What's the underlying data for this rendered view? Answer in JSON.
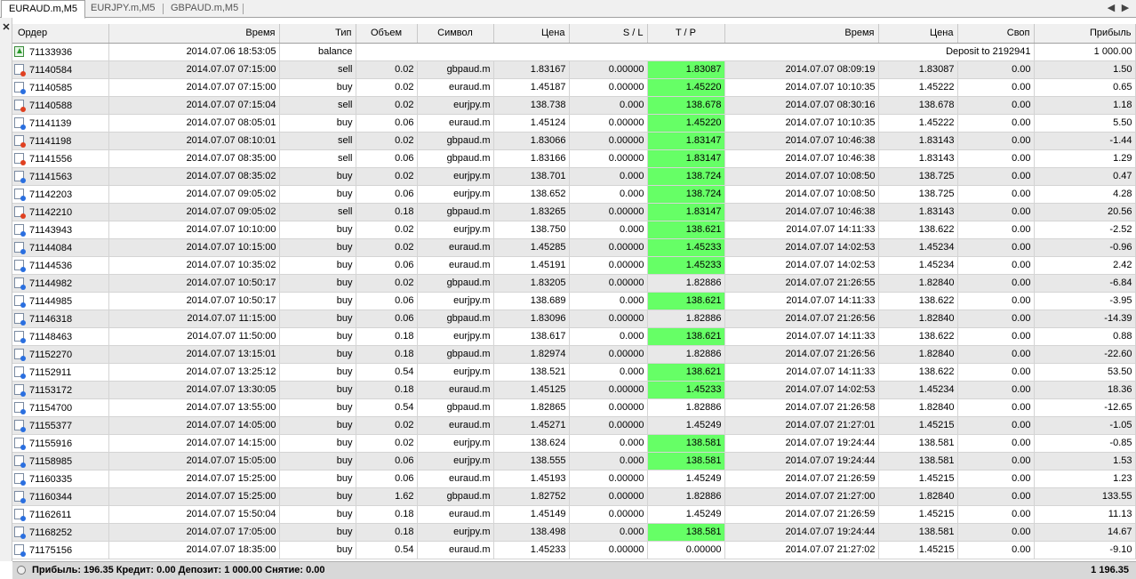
{
  "tabs": [
    {
      "label": "EURAUD.m,M5",
      "active": true
    },
    {
      "label": "EURJPY.m,M5",
      "active": false
    },
    {
      "label": "GBPAUD.m,M5",
      "active": false
    }
  ],
  "columns": [
    "Ордер",
    "Время",
    "Тип",
    "Объем",
    "Символ",
    "Цена",
    "S / L",
    "T / P",
    "Время",
    "Цена",
    "Своп",
    "Прибыль"
  ],
  "balance_row": {
    "order": "71133936",
    "time": "2014.07.06 18:53:05",
    "type": "balance",
    "comment": "Deposit to 2192941",
    "profit": "1 000.00"
  },
  "rows": [
    {
      "order": "71140584",
      "open_time": "2014.07.07 07:15:00",
      "type": "sell",
      "volume": "0.02",
      "symbol": "gbpaud.m",
      "open_price": "1.83167",
      "sl": "0.00000",
      "tp": "1.83087",
      "tp_hit": true,
      "close_time": "2014.07.07 08:09:19",
      "close_price": "1.83087",
      "swap": "0.00",
      "profit": "1.50"
    },
    {
      "order": "71140585",
      "open_time": "2014.07.07 07:15:00",
      "type": "buy",
      "volume": "0.02",
      "symbol": "euraud.m",
      "open_price": "1.45187",
      "sl": "0.00000",
      "tp": "1.45220",
      "tp_hit": true,
      "close_time": "2014.07.07 10:10:35",
      "close_price": "1.45222",
      "swap": "0.00",
      "profit": "0.65"
    },
    {
      "order": "71140588",
      "open_time": "2014.07.07 07:15:04",
      "type": "sell",
      "volume": "0.02",
      "symbol": "eurjpy.m",
      "open_price": "138.738",
      "sl": "0.000",
      "tp": "138.678",
      "tp_hit": true,
      "close_time": "2014.07.07 08:30:16",
      "close_price": "138.678",
      "swap": "0.00",
      "profit": "1.18"
    },
    {
      "order": "71141139",
      "open_time": "2014.07.07 08:05:01",
      "type": "buy",
      "volume": "0.06",
      "symbol": "euraud.m",
      "open_price": "1.45124",
      "sl": "0.00000",
      "tp": "1.45220",
      "tp_hit": true,
      "close_time": "2014.07.07 10:10:35",
      "close_price": "1.45222",
      "swap": "0.00",
      "profit": "5.50"
    },
    {
      "order": "71141198",
      "open_time": "2014.07.07 08:10:01",
      "type": "sell",
      "volume": "0.02",
      "symbol": "gbpaud.m",
      "open_price": "1.83066",
      "sl": "0.00000",
      "tp": "1.83147",
      "tp_hit": true,
      "close_time": "2014.07.07 10:46:38",
      "close_price": "1.83143",
      "swap": "0.00",
      "profit": "-1.44"
    },
    {
      "order": "71141556",
      "open_time": "2014.07.07 08:35:00",
      "type": "sell",
      "volume": "0.06",
      "symbol": "gbpaud.m",
      "open_price": "1.83166",
      "sl": "0.00000",
      "tp": "1.83147",
      "tp_hit": true,
      "close_time": "2014.07.07 10:46:38",
      "close_price": "1.83143",
      "swap": "0.00",
      "profit": "1.29"
    },
    {
      "order": "71141563",
      "open_time": "2014.07.07 08:35:02",
      "type": "buy",
      "volume": "0.02",
      "symbol": "eurjpy.m",
      "open_price": "138.701",
      "sl": "0.000",
      "tp": "138.724",
      "tp_hit": true,
      "close_time": "2014.07.07 10:08:50",
      "close_price": "138.725",
      "swap": "0.00",
      "profit": "0.47"
    },
    {
      "order": "71142203",
      "open_time": "2014.07.07 09:05:02",
      "type": "buy",
      "volume": "0.06",
      "symbol": "eurjpy.m",
      "open_price": "138.652",
      "sl": "0.000",
      "tp": "138.724",
      "tp_hit": true,
      "close_time": "2014.07.07 10:08:50",
      "close_price": "138.725",
      "swap": "0.00",
      "profit": "4.28"
    },
    {
      "order": "71142210",
      "open_time": "2014.07.07 09:05:02",
      "type": "sell",
      "volume": "0.18",
      "symbol": "gbpaud.m",
      "open_price": "1.83265",
      "sl": "0.00000",
      "tp": "1.83147",
      "tp_hit": true,
      "close_time": "2014.07.07 10:46:38",
      "close_price": "1.83143",
      "swap": "0.00",
      "profit": "20.56"
    },
    {
      "order": "71143943",
      "open_time": "2014.07.07 10:10:00",
      "type": "buy",
      "volume": "0.02",
      "symbol": "eurjpy.m",
      "open_price": "138.750",
      "sl": "0.000",
      "tp": "138.621",
      "tp_hit": true,
      "close_time": "2014.07.07 14:11:33",
      "close_price": "138.622",
      "swap": "0.00",
      "profit": "-2.52"
    },
    {
      "order": "71144084",
      "open_time": "2014.07.07 10:15:00",
      "type": "buy",
      "volume": "0.02",
      "symbol": "euraud.m",
      "open_price": "1.45285",
      "sl": "0.00000",
      "tp": "1.45233",
      "tp_hit": true,
      "close_time": "2014.07.07 14:02:53",
      "close_price": "1.45234",
      "swap": "0.00",
      "profit": "-0.96"
    },
    {
      "order": "71144536",
      "open_time": "2014.07.07 10:35:02",
      "type": "buy",
      "volume": "0.06",
      "symbol": "euraud.m",
      "open_price": "1.45191",
      "sl": "0.00000",
      "tp": "1.45233",
      "tp_hit": true,
      "close_time": "2014.07.07 14:02:53",
      "close_price": "1.45234",
      "swap": "0.00",
      "profit": "2.42"
    },
    {
      "order": "71144982",
      "open_time": "2014.07.07 10:50:17",
      "type": "buy",
      "volume": "0.02",
      "symbol": "gbpaud.m",
      "open_price": "1.83205",
      "sl": "0.00000",
      "tp": "1.82886",
      "tp_hit": false,
      "close_time": "2014.07.07 21:26:55",
      "close_price": "1.82840",
      "swap": "0.00",
      "profit": "-6.84"
    },
    {
      "order": "71144985",
      "open_time": "2014.07.07 10:50:17",
      "type": "buy",
      "volume": "0.06",
      "symbol": "eurjpy.m",
      "open_price": "138.689",
      "sl": "0.000",
      "tp": "138.621",
      "tp_hit": true,
      "close_time": "2014.07.07 14:11:33",
      "close_price": "138.622",
      "swap": "0.00",
      "profit": "-3.95"
    },
    {
      "order": "71146318",
      "open_time": "2014.07.07 11:15:00",
      "type": "buy",
      "volume": "0.06",
      "symbol": "gbpaud.m",
      "open_price": "1.83096",
      "sl": "0.00000",
      "tp": "1.82886",
      "tp_hit": false,
      "close_time": "2014.07.07 21:26:56",
      "close_price": "1.82840",
      "swap": "0.00",
      "profit": "-14.39"
    },
    {
      "order": "71148463",
      "open_time": "2014.07.07 11:50:00",
      "type": "buy",
      "volume": "0.18",
      "symbol": "eurjpy.m",
      "open_price": "138.617",
      "sl": "0.000",
      "tp": "138.621",
      "tp_hit": true,
      "close_time": "2014.07.07 14:11:33",
      "close_price": "138.622",
      "swap": "0.00",
      "profit": "0.88"
    },
    {
      "order": "71152270",
      "open_time": "2014.07.07 13:15:01",
      "type": "buy",
      "volume": "0.18",
      "symbol": "gbpaud.m",
      "open_price": "1.82974",
      "sl": "0.00000",
      "tp": "1.82886",
      "tp_hit": false,
      "close_time": "2014.07.07 21:26:56",
      "close_price": "1.82840",
      "swap": "0.00",
      "profit": "-22.60"
    },
    {
      "order": "71152911",
      "open_time": "2014.07.07 13:25:12",
      "type": "buy",
      "volume": "0.54",
      "symbol": "eurjpy.m",
      "open_price": "138.521",
      "sl": "0.000",
      "tp": "138.621",
      "tp_hit": true,
      "close_time": "2014.07.07 14:11:33",
      "close_price": "138.622",
      "swap": "0.00",
      "profit": "53.50"
    },
    {
      "order": "71153172",
      "open_time": "2014.07.07 13:30:05",
      "type": "buy",
      "volume": "0.18",
      "symbol": "euraud.m",
      "open_price": "1.45125",
      "sl": "0.00000",
      "tp": "1.45233",
      "tp_hit": true,
      "close_time": "2014.07.07 14:02:53",
      "close_price": "1.45234",
      "swap": "0.00",
      "profit": "18.36"
    },
    {
      "order": "71154700",
      "open_time": "2014.07.07 13:55:00",
      "type": "buy",
      "volume": "0.54",
      "symbol": "gbpaud.m",
      "open_price": "1.82865",
      "sl": "0.00000",
      "tp": "1.82886",
      "tp_hit": false,
      "close_time": "2014.07.07 21:26:58",
      "close_price": "1.82840",
      "swap": "0.00",
      "profit": "-12.65"
    },
    {
      "order": "71155377",
      "open_time": "2014.07.07 14:05:00",
      "type": "buy",
      "volume": "0.02",
      "symbol": "euraud.m",
      "open_price": "1.45271",
      "sl": "0.00000",
      "tp": "1.45249",
      "tp_hit": false,
      "close_time": "2014.07.07 21:27:01",
      "close_price": "1.45215",
      "swap": "0.00",
      "profit": "-1.05"
    },
    {
      "order": "71155916",
      "open_time": "2014.07.07 14:15:00",
      "type": "buy",
      "volume": "0.02",
      "symbol": "eurjpy.m",
      "open_price": "138.624",
      "sl": "0.000",
      "tp": "138.581",
      "tp_hit": true,
      "close_time": "2014.07.07 19:24:44",
      "close_price": "138.581",
      "swap": "0.00",
      "profit": "-0.85"
    },
    {
      "order": "71158985",
      "open_time": "2014.07.07 15:05:00",
      "type": "buy",
      "volume": "0.06",
      "symbol": "eurjpy.m",
      "open_price": "138.555",
      "sl": "0.000",
      "tp": "138.581",
      "tp_hit": true,
      "close_time": "2014.07.07 19:24:44",
      "close_price": "138.581",
      "swap": "0.00",
      "profit": "1.53"
    },
    {
      "order": "71160335",
      "open_time": "2014.07.07 15:25:00",
      "type": "buy",
      "volume": "0.06",
      "symbol": "euraud.m",
      "open_price": "1.45193",
      "sl": "0.00000",
      "tp": "1.45249",
      "tp_hit": false,
      "close_time": "2014.07.07 21:26:59",
      "close_price": "1.45215",
      "swap": "0.00",
      "profit": "1.23"
    },
    {
      "order": "71160344",
      "open_time": "2014.07.07 15:25:00",
      "type": "buy",
      "volume": "1.62",
      "symbol": "gbpaud.m",
      "open_price": "1.82752",
      "sl": "0.00000",
      "tp": "1.82886",
      "tp_hit": false,
      "close_time": "2014.07.07 21:27:00",
      "close_price": "1.82840",
      "swap": "0.00",
      "profit": "133.55"
    },
    {
      "order": "71162611",
      "open_time": "2014.07.07 15:50:04",
      "type": "buy",
      "volume": "0.18",
      "symbol": "euraud.m",
      "open_price": "1.45149",
      "sl": "0.00000",
      "tp": "1.45249",
      "tp_hit": false,
      "close_time": "2014.07.07 21:26:59",
      "close_price": "1.45215",
      "swap": "0.00",
      "profit": "11.13"
    },
    {
      "order": "71168252",
      "open_time": "2014.07.07 17:05:00",
      "type": "buy",
      "volume": "0.18",
      "symbol": "eurjpy.m",
      "open_price": "138.498",
      "sl": "0.000",
      "tp": "138.581",
      "tp_hit": true,
      "close_time": "2014.07.07 19:24:44",
      "close_price": "138.581",
      "swap": "0.00",
      "profit": "14.67"
    },
    {
      "order": "71175156",
      "open_time": "2014.07.07 18:35:00",
      "type": "buy",
      "volume": "0.54",
      "symbol": "euraud.m",
      "open_price": "1.45233",
      "sl": "0.00000",
      "tp": "0.00000",
      "tp_hit": false,
      "close_time": "2014.07.07 21:27:02",
      "close_price": "1.45215",
      "swap": "0.00",
      "profit": "-9.10"
    }
  ],
  "footer": {
    "summary": "Прибыль: 196.35  Кредит: 0.00  Депозит: 1 000.00  Снятие: 0.00",
    "total": "1 196.35"
  },
  "colors": {
    "tp_hit": "#66ff66",
    "row_alt": "#e8e8e8",
    "buy_dot": "#2a6fe0",
    "sell_dot": "#e04020"
  },
  "icons": {
    "close": "close-icon",
    "scroll_left": "chevron-left-icon",
    "scroll_right": "chevron-right-icon",
    "row_buy": "buy-order-icon",
    "row_sell": "sell-order-icon",
    "row_balance": "balance-icon"
  }
}
